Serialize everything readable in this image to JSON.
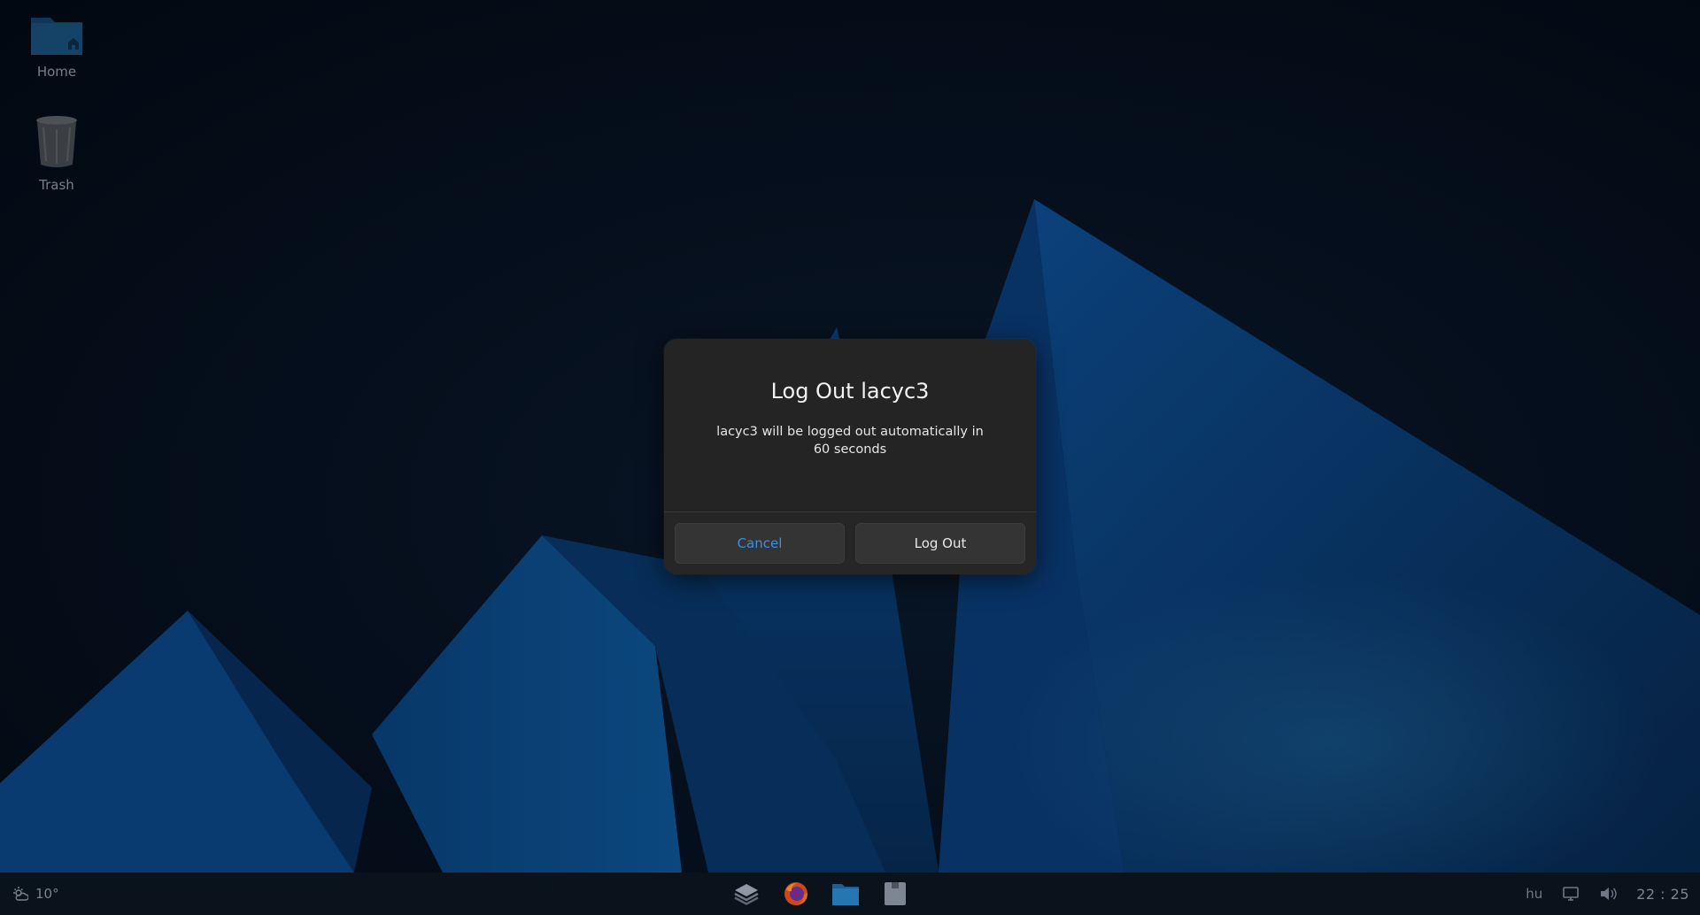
{
  "desktop": {
    "icons": [
      {
        "label": "Home"
      },
      {
        "label": "Trash"
      }
    ]
  },
  "dialog": {
    "title": "Log Out lacyc3",
    "message": "lacyc3 will be logged out automatically in 60 seconds",
    "cancel_label": "Cancel",
    "logout_label": "Log Out",
    "accent_color": "#3b8ee8"
  },
  "taskbar": {
    "weather_temp": "10°",
    "apps": [
      "layers-icon",
      "firefox-icon",
      "file-manager-icon",
      "text-editor-icon"
    ],
    "keyboard_layout": "hu",
    "clock": "22 : 25"
  }
}
